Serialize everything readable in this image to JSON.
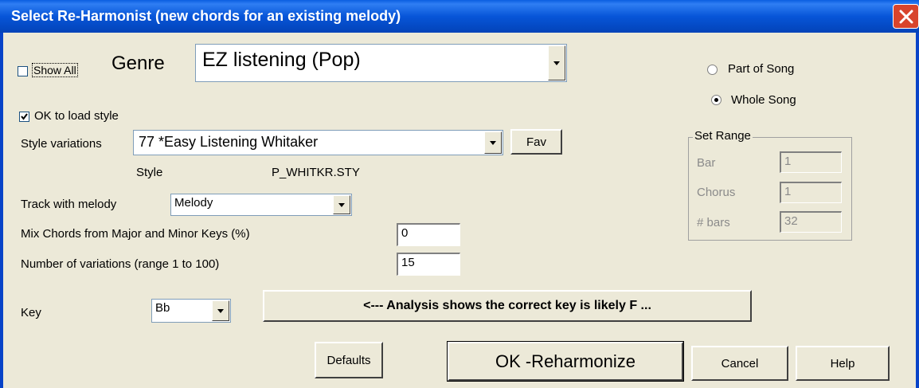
{
  "window": {
    "title": "Select Re-Harmonist (new chords for an existing melody)"
  },
  "show_all": {
    "label": "Show All",
    "checked": false
  },
  "genre": {
    "label": "Genre",
    "value": "EZ listening (Pop)"
  },
  "ok_to_load_style": {
    "label": "OK to load style",
    "checked": true
  },
  "style_variations": {
    "label": "Style variations",
    "value": "77 *Easy Listening Whitaker",
    "fav_label": "Fav"
  },
  "style": {
    "label": "Style",
    "value": "P_WHITKR.STY"
  },
  "track_with_melody": {
    "label": "Track with melody",
    "value": "Melody"
  },
  "mix_chords": {
    "label": "Mix Chords from Major and Minor Keys (%)",
    "value": "0"
  },
  "num_variations": {
    "label": "Number of variations (range 1 to 100)",
    "value": "15"
  },
  "key": {
    "label": "Key",
    "value": "Bb"
  },
  "analysis_button": {
    "label": "<--- Analysis shows the correct key is likely F  ..."
  },
  "range_mode": {
    "options": [
      {
        "label": "Part of Song",
        "selected": false
      },
      {
        "label": "Whole Song",
        "selected": true
      }
    ]
  },
  "set_range": {
    "title": "Set Range",
    "bar": {
      "label": "Bar",
      "value": "1"
    },
    "chorus": {
      "label": "Chorus",
      "value": "1"
    },
    "bars": {
      "label": "# bars",
      "value": "32"
    }
  },
  "buttons": {
    "defaults": "Defaults",
    "ok": "OK -Reharmonize",
    "cancel": "Cancel",
    "help": "Help"
  }
}
